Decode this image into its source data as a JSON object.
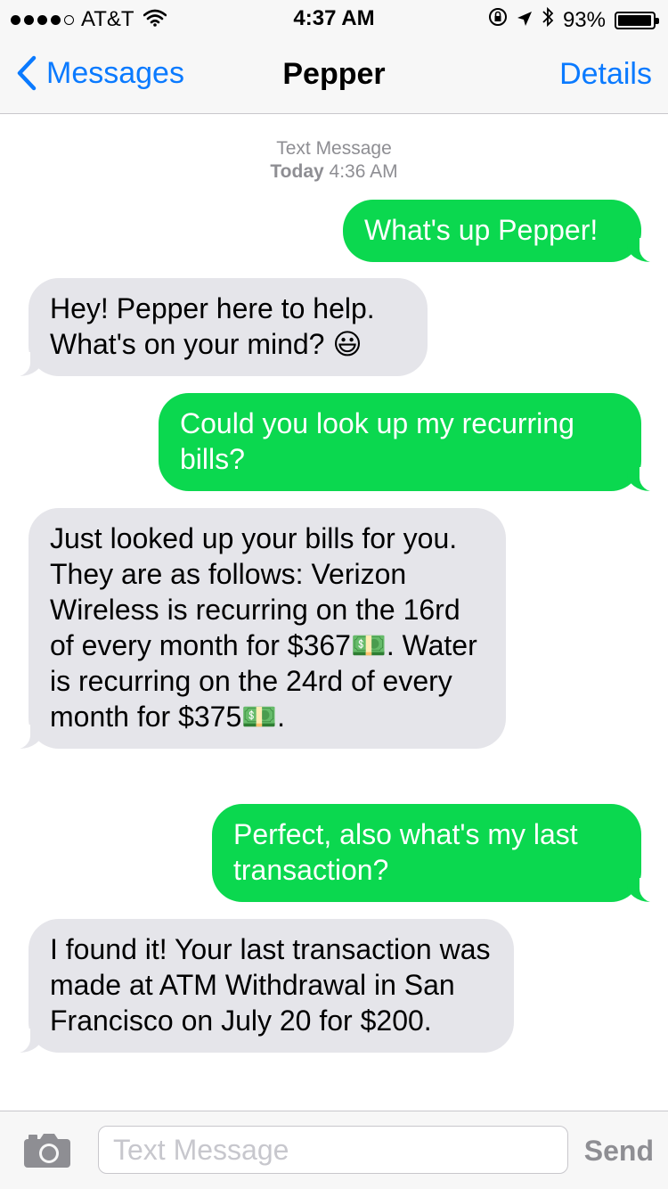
{
  "status_bar": {
    "carrier": "AT&T",
    "time": "4:37 AM",
    "battery": "93%",
    "signal_bars_filled": 4,
    "signal_bars_total": 5,
    "battery_level": 0.93
  },
  "nav": {
    "back_label": "Messages",
    "title": "Pepper",
    "details_label": "Details"
  },
  "thread": {
    "header_label": "Text Message",
    "day": "Today",
    "time": "4:36 AM",
    "messages": [
      {
        "direction": "outgoing",
        "text": "What's up Pepper!"
      },
      {
        "direction": "incoming",
        "text": "Hey! Pepper here to help. What's on your mind? 😃"
      },
      {
        "direction": "outgoing",
        "text": "Could you look up my recurring bills?"
      },
      {
        "direction": "incoming",
        "text": "Just looked up your bills for you. They are as follows: Verizon Wireless is recurring on the 16rd of every month for $367💵. Water is recurring on the 24rd of every month for $375💵."
      },
      {
        "direction": "outgoing",
        "text": "Perfect, also what's my last transaction?"
      },
      {
        "direction": "incoming",
        "text": "I found it! Your last transaction was made at ATM Withdrawal in San Francisco on July 20 for $200."
      }
    ]
  },
  "composer": {
    "placeholder": "Text Message",
    "send_label": "Send"
  },
  "colors": {
    "accent": "#0a7aff",
    "outgoing_bubble": "#0bd84f",
    "incoming_bubble": "#e5e5ea",
    "muted_text": "#8e8e93"
  },
  "icons": [
    "wifi-icon",
    "rotation-lock-icon",
    "location-icon",
    "bluetooth-icon",
    "battery-icon",
    "back-chevron-icon",
    "camera-icon"
  ]
}
